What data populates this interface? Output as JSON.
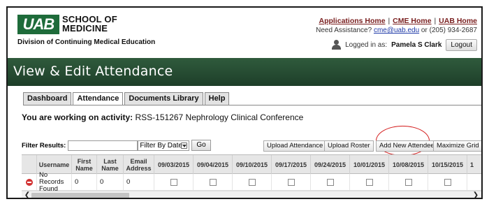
{
  "header": {
    "logo_mark": "UAB",
    "logo_line1": "SCHOOL OF",
    "logo_line2": "MEDICINE",
    "division": "Division of Continuing Medical Education",
    "links": [
      "Applications Home",
      "CME Home",
      "UAB Home"
    ],
    "need_assistance": "Need Assistance?",
    "email": "cme@uab.edu",
    "phone_prefix": "or",
    "phone": "(205) 934-2687",
    "logged_in_label": "Logged in as:",
    "user_name": "Pamela S Clark",
    "logout_label": "Logout"
  },
  "banner": {
    "title": "View & Edit Attendance"
  },
  "tabs": [
    {
      "label": "Dashboard",
      "active": false
    },
    {
      "label": "Attendance",
      "active": true
    },
    {
      "label": "Documents Library",
      "active": false
    },
    {
      "label": "Help",
      "active": false
    }
  ],
  "activity": {
    "prefix": "You are working on activity:",
    "name": "RSS-151267 Nephrology Clinical Conference"
  },
  "filter": {
    "label": "Filter Results:",
    "input_value": "",
    "select_value": "Filter By Date",
    "go_label": "Go"
  },
  "actions": {
    "upload_attendance": "Upload Attendance",
    "upload_roster": "Upload Roster",
    "add_new_attendee": "Add New Attendee",
    "maximize_grid": "Maximize Grid"
  },
  "grid": {
    "columns": [
      "Username",
      "First Name",
      "Last Name",
      "Email Address",
      "09/03/2015",
      "09/04/2015",
      "09/10/2015",
      "09/17/2015",
      "09/24/2015",
      "10/01/2015",
      "10/08/2015",
      "10/15/2015",
      "1"
    ],
    "row": {
      "username": "No Records Found",
      "first_name": "0",
      "last_name": "0",
      "email": "0"
    }
  },
  "colors": {
    "brand_green": "#1e6b3a",
    "banner_green": "#2f5a3c",
    "link_maroon": "#7a2020",
    "annotation_red": "#d41e1e"
  },
  "icons": [
    "user-icon",
    "delete-icon",
    "chevron-down-icon",
    "scroll-left-icon",
    "scroll-right-icon"
  ]
}
